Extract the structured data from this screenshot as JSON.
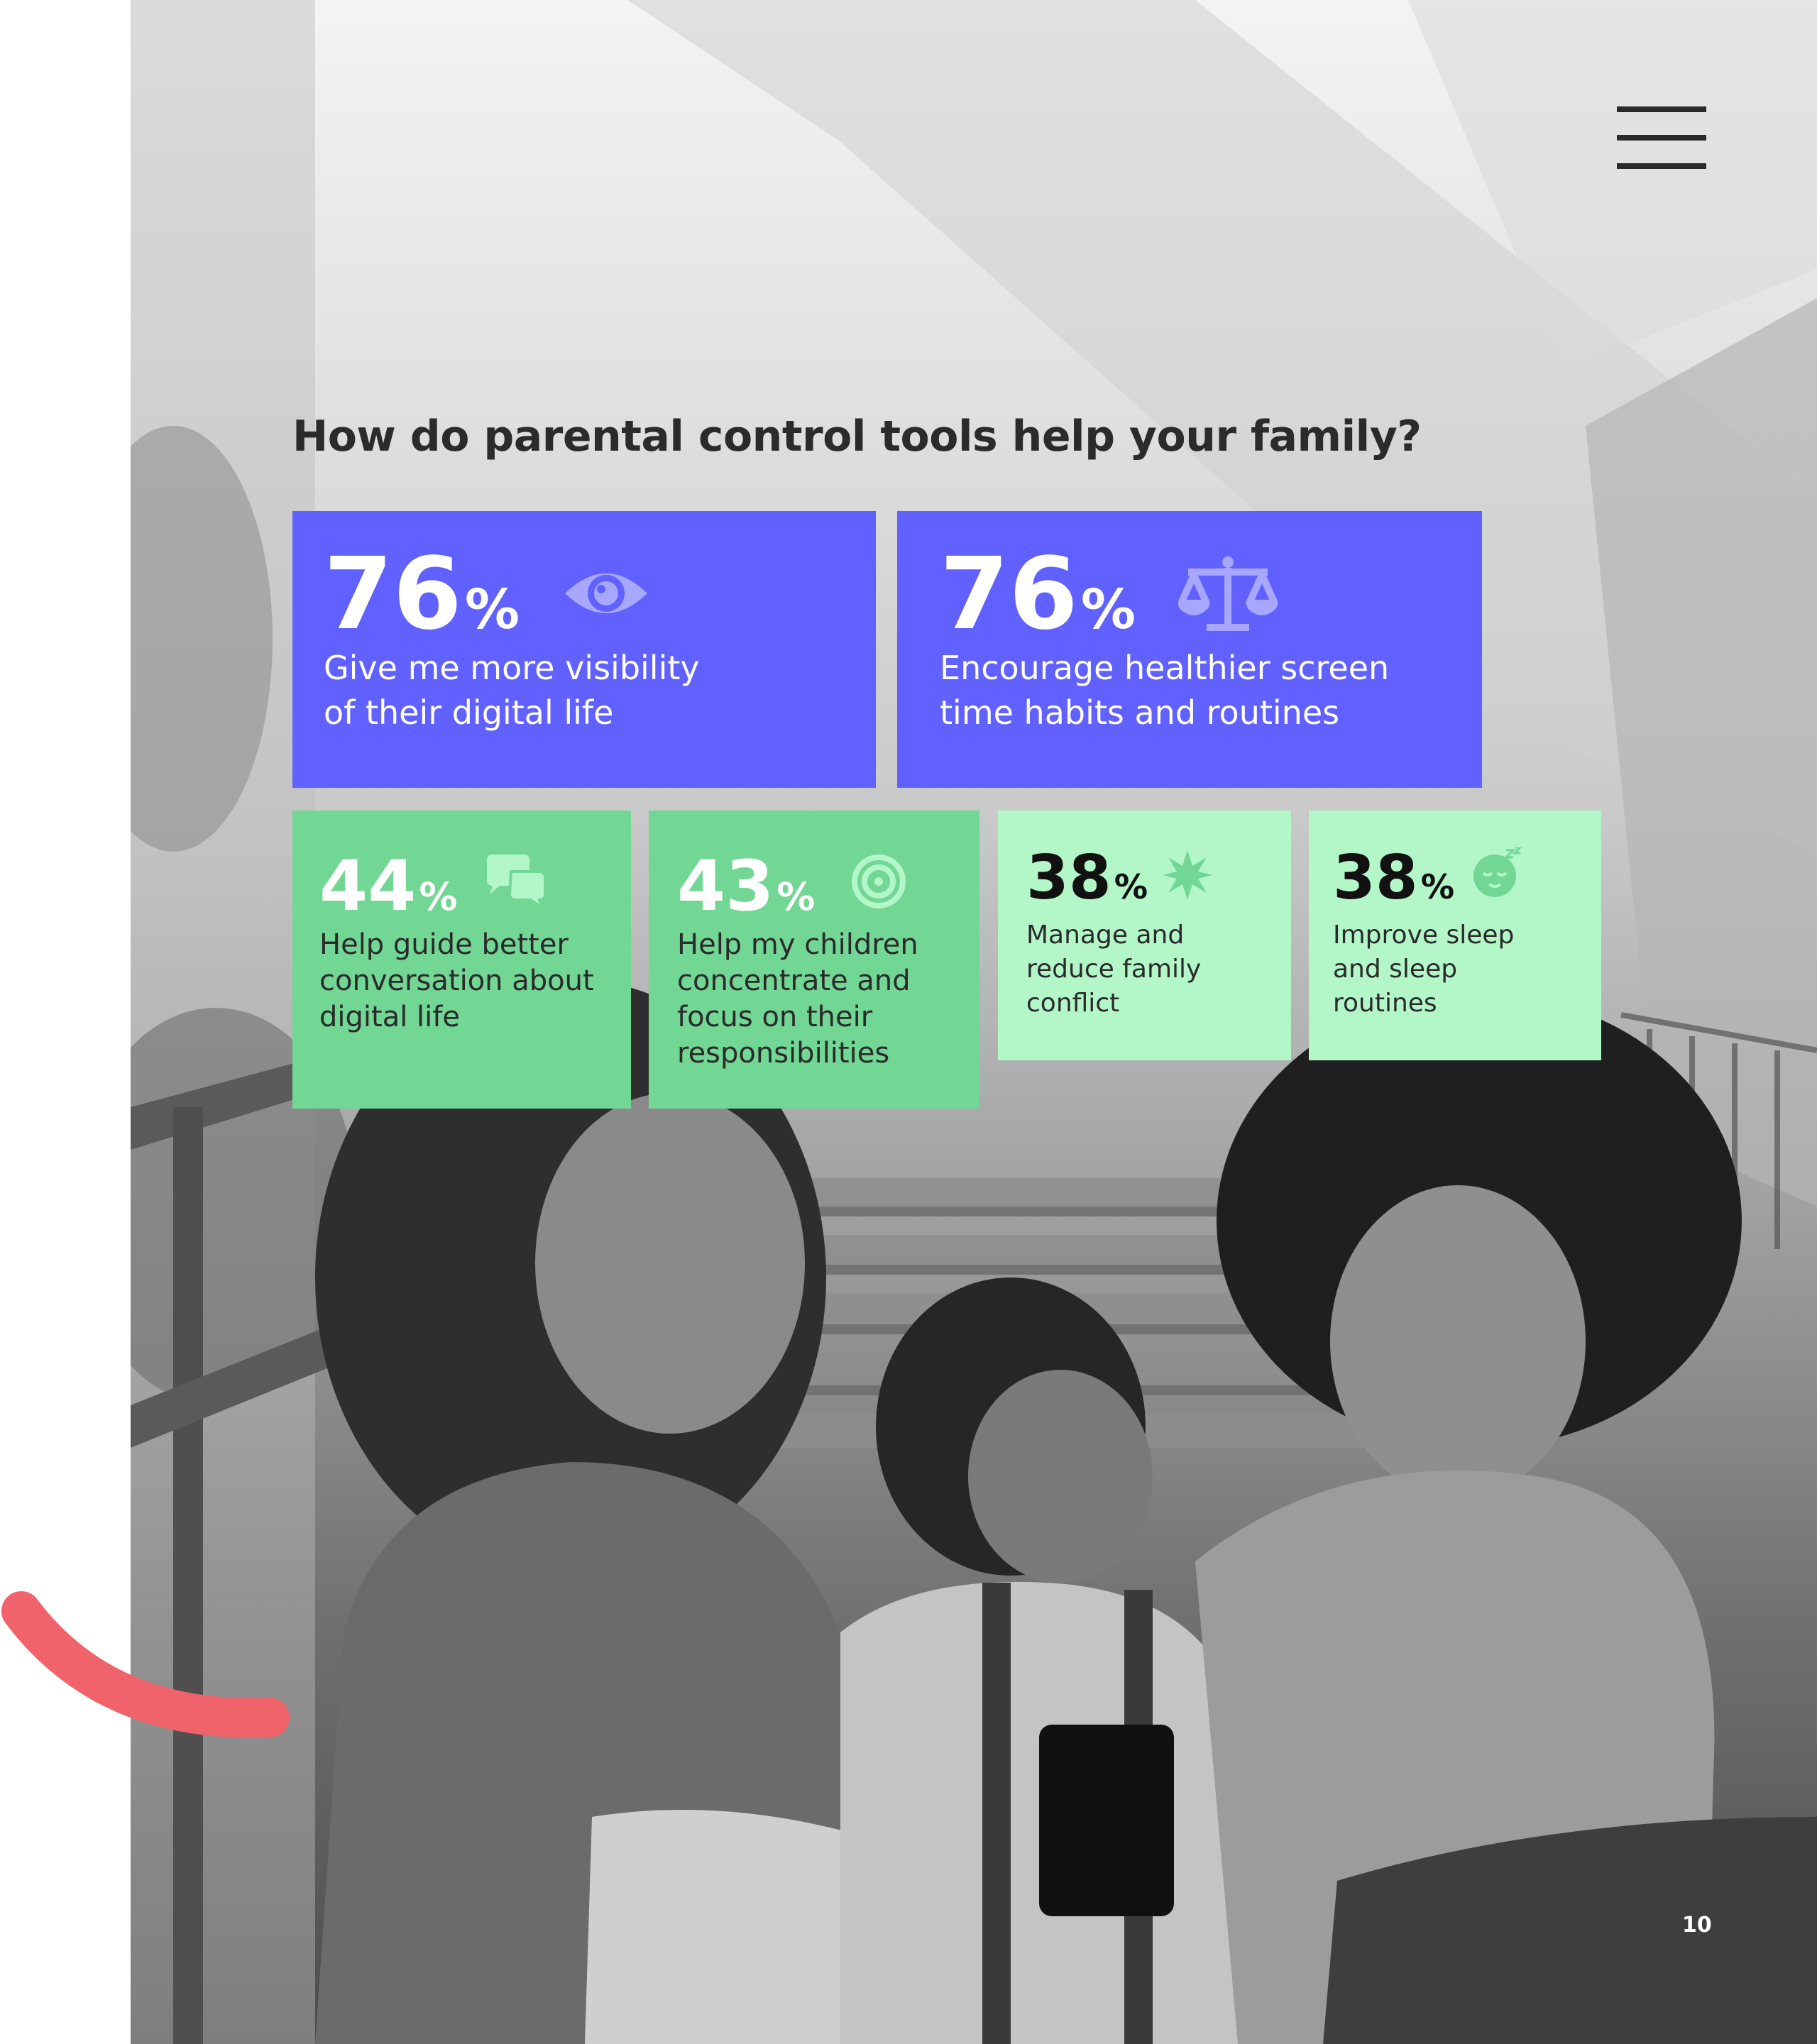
{
  "page": {
    "title": "How do parental control tools help your family?",
    "page_number": "10"
  },
  "menu": {
    "icon": "hamburger-menu-icon"
  },
  "cards": [
    {
      "value": "76",
      "unit": "%",
      "icon": "eye-icon",
      "lines": [
        "Give me more visibility",
        "of their digital life"
      ]
    },
    {
      "value": "76",
      "unit": "%",
      "icon": "scale-icon",
      "lines": [
        "Encourage healthier screen",
        "time habits and routines"
      ]
    },
    {
      "value": "44",
      "unit": "%",
      "icon": "chat-bubbles-icon",
      "lines": [
        "Help guide better",
        "conversation about",
        "digital life"
      ]
    },
    {
      "value": "43",
      "unit": "%",
      "icon": "target-icon",
      "lines": [
        "Help my children",
        "concentrate and",
        "focus on their",
        "responsibilities"
      ]
    },
    {
      "value": "38",
      "unit": "%",
      "icon": "burst-icon",
      "lines": [
        "Manage and",
        "reduce family",
        "conflict"
      ]
    },
    {
      "value": "38",
      "unit": "%",
      "icon": "sleepy-face-icon",
      "lines": [
        "Improve sleep",
        "and sleep",
        "routines"
      ]
    }
  ],
  "colors": {
    "purple": "#6161FF",
    "green": "#72D694",
    "mint": "#B3F7C8",
    "accent_arc": "#F0636A",
    "title": "#2B2B2B"
  }
}
